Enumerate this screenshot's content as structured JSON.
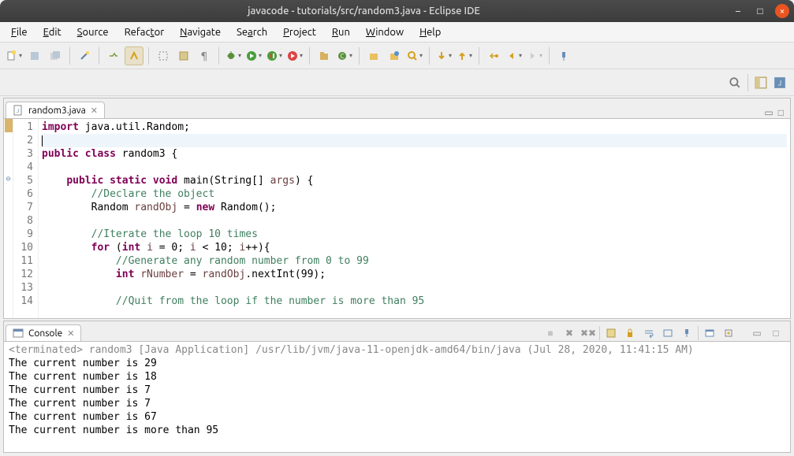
{
  "window": {
    "title": "javacode - tutorials/src/random3.java - Eclipse IDE"
  },
  "menu": [
    "File",
    "Edit",
    "Source",
    "Refactor",
    "Navigate",
    "Search",
    "Project",
    "Run",
    "Window",
    "Help"
  ],
  "menu_underline": [
    0,
    0,
    0,
    5,
    0,
    2,
    0,
    0,
    0,
    0
  ],
  "editor_tab": {
    "label": "random3.java"
  },
  "code_lines": [
    {
      "n": "1",
      "html": "<span class='kw'>import</span> java.util.Random;"
    },
    {
      "n": "2",
      "html": "",
      "cursor": true
    },
    {
      "n": "3",
      "html": "<span class='kw'>public</span> <span class='kw'>class</span> random3 {"
    },
    {
      "n": "4",
      "html": ""
    },
    {
      "n": "5",
      "html": "    <span class='kw'>public</span> <span class='kw'>static</span> <span class='kw'>void</span> main(String[] <span class='var'>args</span>) {",
      "marker": "⊖"
    },
    {
      "n": "6",
      "html": "        <span class='com'>//Declare the object</span>"
    },
    {
      "n": "7",
      "html": "        Random <span class='var'>randObj</span> = <span class='kw'>new</span> Random();"
    },
    {
      "n": "8",
      "html": ""
    },
    {
      "n": "9",
      "html": "        <span class='com'>//Iterate the loop 10 times</span>"
    },
    {
      "n": "10",
      "html": "        <span class='kw'>for</span> (<span class='kw'>int</span> <span class='var'>i</span> = 0; <span class='var'>i</span> &lt; 10; <span class='var'>i</span>++){"
    },
    {
      "n": "11",
      "html": "            <span class='com'>//Generate any random number from 0 to 99</span>"
    },
    {
      "n": "12",
      "html": "            <span class='kw'>int</span> <span class='var'>rNumber</span> = <span class='var'>randObj</span>.nextInt(99);"
    },
    {
      "n": "13",
      "html": ""
    },
    {
      "n": "14",
      "html": "            <span class='com'>//Quit from the loop if the number is more than 95</span>"
    }
  ],
  "console_tab": {
    "label": "Console"
  },
  "console_header": "<terminated> random3 [Java Application] /usr/lib/jvm/java-11-openjdk-amd64/bin/java (Jul 28, 2020, 11:41:15 AM)",
  "console_output": [
    "The current number is 29",
    "The current number is 18",
    "The current number is 7",
    "The current number is 7",
    "The current number is 67",
    "The current number is more than 95"
  ]
}
